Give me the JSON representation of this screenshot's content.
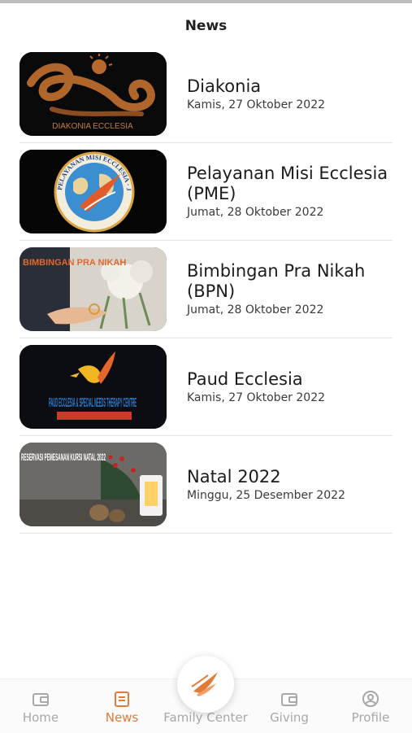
{
  "header": {
    "title": "News"
  },
  "news": [
    {
      "title": "Diakonia",
      "date": "Kamis, 27 Oktober 2022",
      "image_text": "DIAKONIA ECCLESIA",
      "icon": "diakonia-logo"
    },
    {
      "title": "Pelayanan Misi Ecclesia (PME)",
      "date": "Jumat, 28 Oktober 2022",
      "image_text": "PELAYANAN MISI ECCLESIA · JAKARTA",
      "icon": "pme-globe-logo"
    },
    {
      "title": "Bimbingan Pra Nikah (BPN)",
      "date": "Jumat, 28 Oktober 2022",
      "image_text": "BIMBINGAN PRA NIKAH",
      "icon": "wedding-photo"
    },
    {
      "title": "Paud Ecclesia",
      "date": "Kamis, 27 Oktober 2022",
      "image_text": "PAUD ECCLESIA & SPECIAL NEEDS THERAPY CENTRE",
      "icon": "paud-logo"
    },
    {
      "title": "Natal 2022",
      "date": "Minggu, 25 Desember 2022",
      "image_text": "RESERVASI PEMESANAN KURSI NATAL 2022",
      "icon": "christmas-photo"
    }
  ],
  "nav": {
    "items": [
      {
        "label": "Home",
        "icon": "wallet-icon",
        "active": false
      },
      {
        "label": "News",
        "icon": "document-icon",
        "active": true
      },
      {
        "label": "Family Center",
        "icon": "dove-logo-icon",
        "active": false
      },
      {
        "label": "Giving",
        "icon": "wallet-icon",
        "active": false
      },
      {
        "label": "Profile",
        "icon": "user-circle-icon",
        "active": false
      }
    ]
  },
  "colors": {
    "accent": "#e07b39",
    "inactive": "#a8a8a8",
    "text": "#1d1d1d"
  }
}
